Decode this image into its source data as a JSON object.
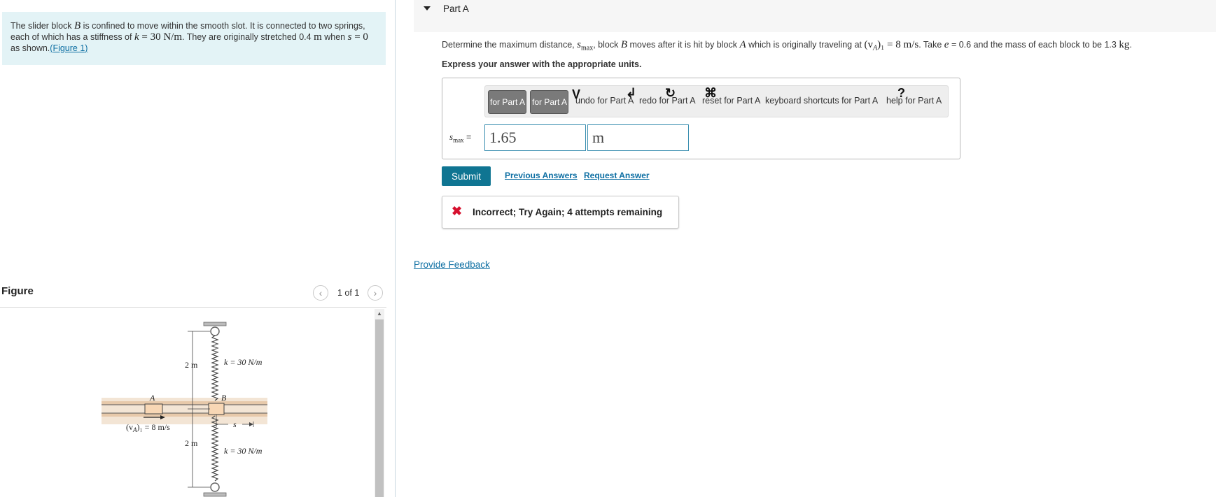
{
  "problem": {
    "text_part1": "The slider block ",
    "var_B": "B",
    "text_part2": " is confined to move within the smooth slot. It is connected to two springs, each of which has a stiffness of ",
    "var_k": "k",
    "k_eq": " = 30 ",
    "k_unit": "N/m",
    "text_part3": ". They are originally stretched 0.4 ",
    "m_unit": "m",
    "text_part4": " when ",
    "var_s": "s",
    "s_eq": " = 0",
    "text_part5": " as shown.",
    "figure_link": "(Figure 1)"
  },
  "figure": {
    "title": "Figure",
    "counter": "1 of 1",
    "prev_icon": "chevron-left-icon",
    "next_icon": "chevron-right-icon",
    "labels": {
      "top_distance": "2 m",
      "bottom_distance": "2 m",
      "k_top": "k = 30 N/m",
      "k_bottom": "k = 30 N/m",
      "block_A": "A",
      "block_B": "B",
      "velocity": "(v",
      "velocity_sub": "A",
      "velocity_rest": ")₁ = 8 m/s",
      "s_label": "s"
    }
  },
  "part": {
    "title": "Part A",
    "question": {
      "t1": "Determine the maximum distance, ",
      "smax": "s",
      "smax_sub": "max",
      "t2": ", block ",
      "B": "B",
      "t3": " moves after it is hit by block ",
      "A": "A",
      "t4": " which is originally traveling at ",
      "vA": "(v",
      "vA_sub": "A",
      "vA_rest": ")₁ = 8 m/s",
      "t5": ". Take ",
      "e": "e",
      "t6": " = 0.6 and the mass of each block to be 1.3 ",
      "kg": "kg",
      "t7": "."
    },
    "instruction": "Express your answer with the appropriate units.",
    "toolbar": {
      "templates": "for Part A",
      "symbols": "for Part A",
      "undo": "undo for Part A",
      "redo": "redo for Part A",
      "reset": "reset for Part A",
      "keyboard": "keyboard shortcuts for Part A",
      "help": "help for Part A"
    },
    "answer_label": "s",
    "answer_label_sub": "max",
    "answer_label_eq": " =",
    "value": "1.65",
    "unit": "m",
    "submit_label": "Submit",
    "previous_answers": "Previous Answers",
    "request_answer": "Request Answer",
    "feedback": "Incorrect; Try Again; 4 attempts remaining",
    "feedback_icon": "x-error-icon"
  },
  "provide_feedback": "Provide Feedback",
  "colors": {
    "problem_bg": "#e3f3f6",
    "link": "#0e6fa3",
    "submit": "#0f7592",
    "error": "#d6102e",
    "input_border": "#3b8fb0"
  }
}
